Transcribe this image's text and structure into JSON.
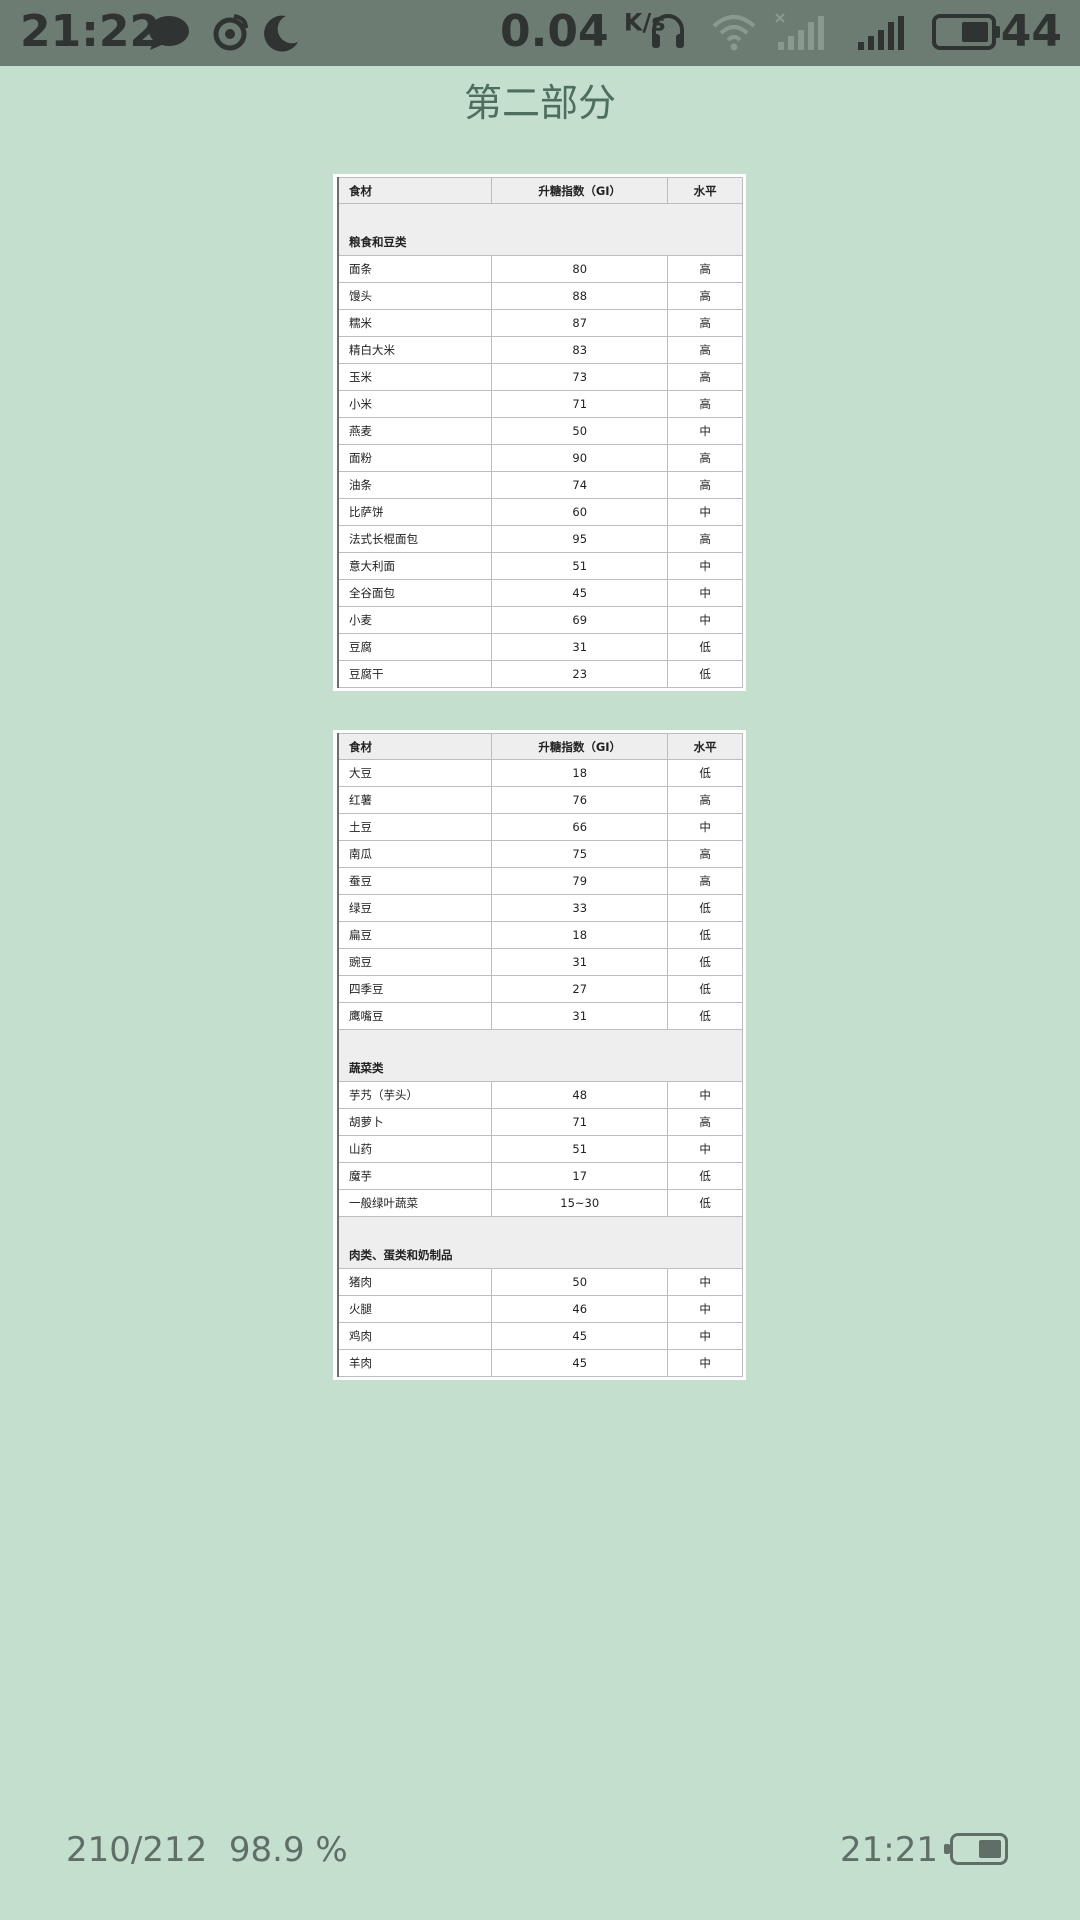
{
  "status_bar": {
    "time": "21:22",
    "speed_value": "0.04",
    "speed_unit": "K/s",
    "battery_percent": "44",
    "icons": [
      "chat-bubble-icon",
      "weibo-icon",
      "moon-icon",
      "headphones-icon",
      "wifi-icon",
      "signal-weak-icon",
      "signal-strong-icon",
      "battery-icon"
    ]
  },
  "page": {
    "title": "第二部分"
  },
  "table1": {
    "headers": [
      "食材",
      "升糖指数（GI）",
      "水平"
    ],
    "category": "粮食和豆类",
    "rows": [
      [
        "面条",
        "80",
        "高"
      ],
      [
        "馒头",
        "88",
        "高"
      ],
      [
        "糯米",
        "87",
        "高"
      ],
      [
        "精白大米",
        "83",
        "高"
      ],
      [
        "玉米",
        "73",
        "高"
      ],
      [
        "小米",
        "71",
        "高"
      ],
      [
        "燕麦",
        "50",
        "中"
      ],
      [
        "面粉",
        "90",
        "高"
      ],
      [
        "油条",
        "74",
        "高"
      ],
      [
        "比萨饼",
        "60",
        "中"
      ],
      [
        "法式长棍面包",
        "95",
        "高"
      ],
      [
        "意大利面",
        "51",
        "中"
      ],
      [
        "全谷面包",
        "45",
        "中"
      ],
      [
        "小麦",
        "69",
        "中"
      ],
      [
        "豆腐",
        "31",
        "低"
      ],
      [
        "豆腐干",
        "23",
        "低"
      ]
    ]
  },
  "table2": {
    "headers": [
      "食材",
      "升糖指数（GI）",
      "水平"
    ],
    "rows_a": [
      [
        "大豆",
        "18",
        "低"
      ],
      [
        "红薯",
        "76",
        "高"
      ],
      [
        "土豆",
        "66",
        "中"
      ],
      [
        "南瓜",
        "75",
        "高"
      ],
      [
        "蚕豆",
        "79",
        "高"
      ],
      [
        "绿豆",
        "33",
        "低"
      ],
      [
        "扁豆",
        "18",
        "低"
      ],
      [
        "豌豆",
        "31",
        "低"
      ],
      [
        "四季豆",
        "27",
        "低"
      ],
      [
        "鹰嘴豆",
        "31",
        "低"
      ]
    ],
    "category_b": "蔬菜类",
    "rows_b": [
      [
        "芋艿（芋头）",
        "48",
        "中"
      ],
      [
        "胡萝卜",
        "71",
        "高"
      ],
      [
        "山药",
        "51",
        "中"
      ],
      [
        "魔芋",
        "17",
        "低"
      ],
      [
        "一般绿叶蔬菜",
        "15~30",
        "低"
      ]
    ],
    "category_c": "肉类、蛋类和奶制品",
    "rows_c": [
      [
        "猪肉",
        "50",
        "中"
      ],
      [
        "火腿",
        "46",
        "中"
      ],
      [
        "鸡肉",
        "45",
        "中"
      ],
      [
        "羊肉",
        "45",
        "中"
      ]
    ]
  },
  "footer": {
    "page_position": "210/212",
    "progress": "98.9 %",
    "clock": "21:21"
  }
}
